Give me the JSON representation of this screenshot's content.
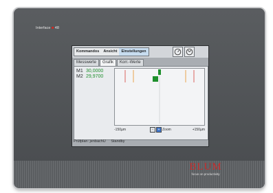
{
  "device": {
    "label_prefix": "Interface",
    "label_mark": "■",
    "label_number": "48",
    "brand": "BLUM",
    "tagline": "focus on productivity"
  },
  "menubar": {
    "items": [
      "Kommandos",
      "Ansicht",
      "Einstellungen"
    ],
    "active_index": 2,
    "icons": [
      "gauge-icon",
      "gauge-settings-icon"
    ]
  },
  "tabs": [
    "Messwerte",
    "Grafik",
    "Korr.-Werte"
  ],
  "active_tab": 1,
  "measurements": [
    {
      "label": "M1",
      "value": "30,0000"
    },
    {
      "label": "M2",
      "value": "29,9700"
    }
  ],
  "graph": {
    "axis_min_label": "-150µm",
    "axis_max_label": "+150µm",
    "zoom_label": "Zoom",
    "zoom_buttons": [
      "-",
      "+"
    ],
    "marker_colors": {
      "red": "#d9534f",
      "orange": "#e79a3a",
      "green": "#1e8f2c"
    }
  },
  "status": {
    "plan": "Prüfplan: jenbachU",
    "state": "Standby"
  }
}
